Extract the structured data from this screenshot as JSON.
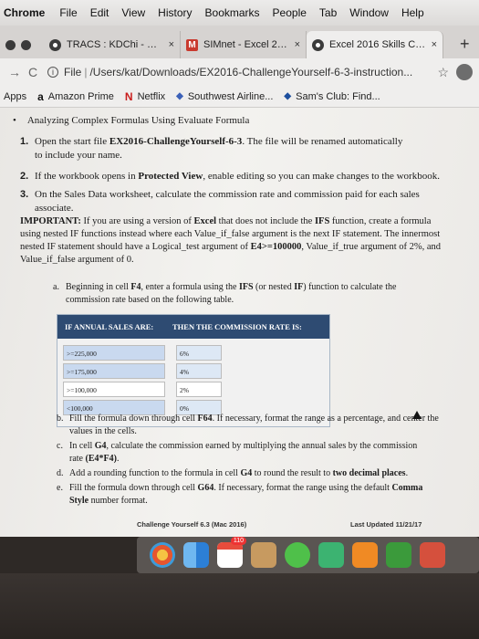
{
  "menubar": {
    "app": "Chrome",
    "items": [
      "File",
      "Edit",
      "View",
      "History",
      "Bookmarks",
      "People",
      "Tab",
      "Window",
      "Help"
    ]
  },
  "tabs": [
    {
      "title": "TRACS : KDChi - Omic",
      "close": "×"
    },
    {
      "title": "SIMnet - Excel 2016 S",
      "close": "×"
    },
    {
      "title": "Excel 2016 Skills Chall",
      "close": "×"
    }
  ],
  "newtab": "+",
  "toolbar": {
    "url_scheme": "File",
    "url_path": "/Users/kat/Downloads/EX2016-ChallengeYourself-6-3-instruction..."
  },
  "bookmarks": [
    {
      "label": "Apps"
    },
    {
      "label": "Amazon Prime",
      "icon": "a"
    },
    {
      "label": "Netflix",
      "icon": "N"
    },
    {
      "label": "Southwest Airline...",
      "icon": "◆"
    },
    {
      "label": "Sam's Club: Find...",
      "icon": "◆"
    }
  ],
  "doc": {
    "topline": "Analyzing Complex Formulas Using Evaluate Formula",
    "step1_num": "1.",
    "step1_a": "Open the start file ",
    "step1_file": "EX2016-ChallengeYourself-6-3",
    "step1_b": ". The file will be renamed automatically",
    "step1_c": "to include your name.",
    "step2_num": "2.",
    "step2_a": "If the workbook opens in ",
    "step2_b": "Protected View",
    "step2_c": ", enable editing so you can make changes to the workbook.",
    "step3_num": "3.",
    "step3_a": "On the Sales Data worksheet, calculate the commission rate and commission paid for each sales",
    "step3_b": "associate.",
    "important_label": "IMPORTANT:",
    "important_1": " If you are using a version of ",
    "important_excel": "Excel",
    "important_2": " that does not include the ",
    "important_ifs": "IFS",
    "important_3": " function, create a formula using nested IF functions instead where each Value_if_false argument is the next IF statement. The innermost nested IF statement should have a Logical_test argument of ",
    "important_test": "E4>=100000",
    "important_4": ", Value_if_true argument of 2%, and Value_if_false argument of 0.",
    "sub_a_letter": "a.",
    "sub_a_1": "Beginning in cell ",
    "sub_a_cell": "F4",
    "sub_a_2": ", enter a formula using the ",
    "sub_a_ifs": "IFS",
    "sub_a_3": " (or nested ",
    "sub_a_if": "IF",
    "sub_a_4": ") function to calculate the",
    "sub_a_5": "commission rate based on the following table.",
    "table": {
      "header1": "IF ANNUAL SALES ARE:",
      "header2": "THEN THE COMMISSION RATE IS:",
      "rows": [
        {
          "sales": ">=225,000",
          "rate": "6%"
        },
        {
          "sales": ">=175,000",
          "rate": "4%"
        },
        {
          "sales": ">=100,000",
          "rate": "2%"
        },
        {
          "sales": "<100,000",
          "rate": "0%"
        }
      ]
    },
    "sub_b_letter": "b.",
    "sub_b_1": "Fill the formula down through cell ",
    "sub_b_cell": "F64",
    "sub_b_2": ". If necessary, format the range as a percentage, and center the",
    "sub_b_3": "values in the cells.",
    "sub_c_letter": "c.",
    "sub_c_1": "In cell ",
    "sub_c_cell": "G4",
    "sub_c_2": ", calculate the commission earned by multiplying the annual sales by the commission",
    "sub_c_3": "rate ",
    "sub_c_formula": "(E4*F4)",
    "sub_c_4": ".",
    "sub_d_letter": "d.",
    "sub_d_1": "Add a rounding function to the formula in cell ",
    "sub_d_cell": "G4",
    "sub_d_2": " to round the result to ",
    "sub_d_bold": "two decimal places",
    "sub_d_3": ".",
    "sub_e_letter": "e.",
    "sub_e_1": "Fill the formula down through cell ",
    "sub_e_cell": "G64",
    "sub_e_2": ". If necessary, format the range using the default ",
    "sub_e_bold": "Comma",
    "sub_e_3": "Style",
    "sub_e_4": " number format.",
    "footer_left": "Challenge Yourself 6.3 (Mac 2016)",
    "footer_right": "Last Updated 11/21/17"
  },
  "dock": {
    "apps": [
      "photos",
      "finder",
      "calendar",
      "contacts",
      "messages",
      "facetime",
      "books",
      "numbers",
      "keynote"
    ],
    "badge": "110"
  }
}
